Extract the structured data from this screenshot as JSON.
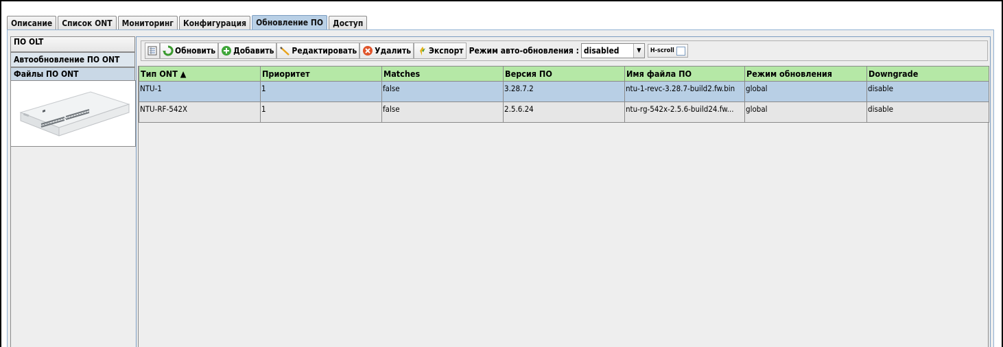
{
  "main_tabs": [
    "Описание",
    "Список ONT",
    "Мониторинг",
    "Конфигурация",
    "Обновление ПО",
    "Доступ"
  ],
  "active_main_tab": "Обновление ПО",
  "side_tabs": [
    "ПО OLT",
    "Автообновление ПО ONT",
    "Файлы ПО ONT"
  ],
  "toolbar": {
    "refresh_label": "Обновить",
    "add_label": "Добавить",
    "edit_label": "Редактировать",
    "delete_label": "Удалить",
    "export_label": "Экспорт",
    "mode_label": "Режим авто-обновления :",
    "mode_value": "disabled",
    "hscroll_label": "H-scroll"
  },
  "table": {
    "columns": [
      "Тип ONT ▲",
      "Приоритет",
      "Matches",
      "Версия ПО",
      "Имя файла ПО",
      "Режим обновления",
      "Downgrade"
    ],
    "rows": [
      [
        "NTU-1",
        "1",
        "false",
        "3.28.7.2",
        "ntu-1-revc-3.28.7-build2.fw.bin",
        "global",
        "disable"
      ],
      [
        "NTU-RF-542X",
        "1",
        "false",
        "2.5.6.24",
        "ntu-rg-542x-2.5.6-build24.fw...",
        "global",
        "disable"
      ]
    ],
    "selected_row": 0
  },
  "colors": {
    "header_bg": "#b5e8a6",
    "selected_row_bg": "#b8cfe5",
    "active_tab_bg": "#b9d0e6"
  }
}
